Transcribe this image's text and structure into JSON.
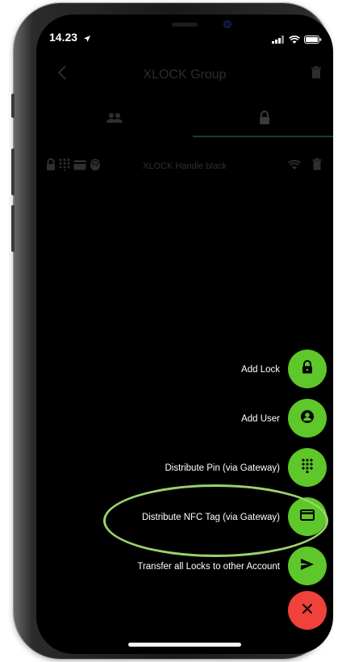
{
  "status": {
    "time": "14.23"
  },
  "navbar": {
    "title": "XLOCK Group"
  },
  "lock_row": {
    "name": "XLOCK Handle black"
  },
  "fab_menu": {
    "items": [
      {
        "label": "Add Lock",
        "icon": "lock-icon"
      },
      {
        "label": "Add User",
        "icon": "user-icon"
      },
      {
        "label": "Distribute Pin (via Gateway)",
        "icon": "keypad-icon"
      },
      {
        "label": "Distribute NFC Tag (via Gateway)",
        "icon": "card-icon"
      },
      {
        "label": "Transfer all Locks to other Account",
        "icon": "send-icon"
      }
    ],
    "close_icon": "close-icon"
  },
  "colors": {
    "fab_green": "#5ec72a",
    "fab_red": "#f0413b",
    "highlight": "#9cd26a",
    "background": "#000000"
  }
}
